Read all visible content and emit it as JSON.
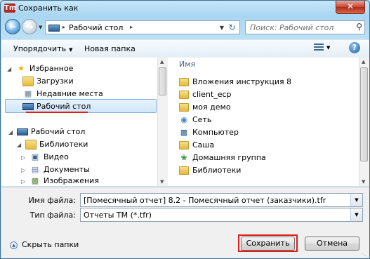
{
  "window": {
    "title": "Сохранить как",
    "logo_text": "Tm"
  },
  "titlebar": {
    "close_label": "✕"
  },
  "address": {
    "current": "Рабочий стол",
    "separator": "▸"
  },
  "search": {
    "placeholder": "Поиск: Рабочий стол"
  },
  "toolbar": {
    "organize_label": "Упорядочить",
    "new_folder_label": "Новая папка",
    "help_label": "?"
  },
  "nav": {
    "favorites": {
      "label": "Избранное"
    },
    "favorites_items": [
      {
        "label": "Загрузки",
        "icon": "downloads-icon"
      },
      {
        "label": "Недавние места",
        "icon": "recent-places-icon"
      },
      {
        "label": "Рабочий стол",
        "icon": "desktop-icon",
        "selected": true
      }
    ],
    "tree": [
      {
        "label": "Рабочий стол",
        "icon": "desktop-icon"
      },
      {
        "label": "Библиотеки",
        "icon": "libraries-icon"
      },
      {
        "label": "Видео",
        "icon": "video-icon"
      },
      {
        "label": "Документы",
        "icon": "documents-icon"
      },
      {
        "label": "Изображения",
        "icon": "pictures-icon"
      }
    ]
  },
  "files": {
    "column_name": "Имя",
    "items": [
      {
        "label": "Вложения инструкция 8",
        "icon": "folder-icon"
      },
      {
        "label": "client_ecp",
        "icon": "folder-icon"
      },
      {
        "label": "моя демо",
        "icon": "folder-icon"
      },
      {
        "label": "Сеть",
        "icon": "network-icon"
      },
      {
        "label": "Компьютер",
        "icon": "computer-icon"
      },
      {
        "label": "Саша",
        "icon": "user-folder-icon"
      },
      {
        "label": "Домашняя группа",
        "icon": "homegroup-icon"
      },
      {
        "label": "Библиотеки",
        "icon": "libraries-icon"
      }
    ]
  },
  "form": {
    "filename_label": "Имя файла:",
    "filename_value": "[Помесячный отчет] 8.2 - Помесячный отчет (заказчики).tfr",
    "filetype_label": "Тип файла:",
    "filetype_value": "Отчеты ТМ (*.tfr)",
    "hide_folders_label": "Скрыть папки",
    "save_label": "Сохранить",
    "cancel_label": "Отмена"
  },
  "colors": {
    "highlight_red": "#e01e1e",
    "selection_border": "#84acdd"
  }
}
